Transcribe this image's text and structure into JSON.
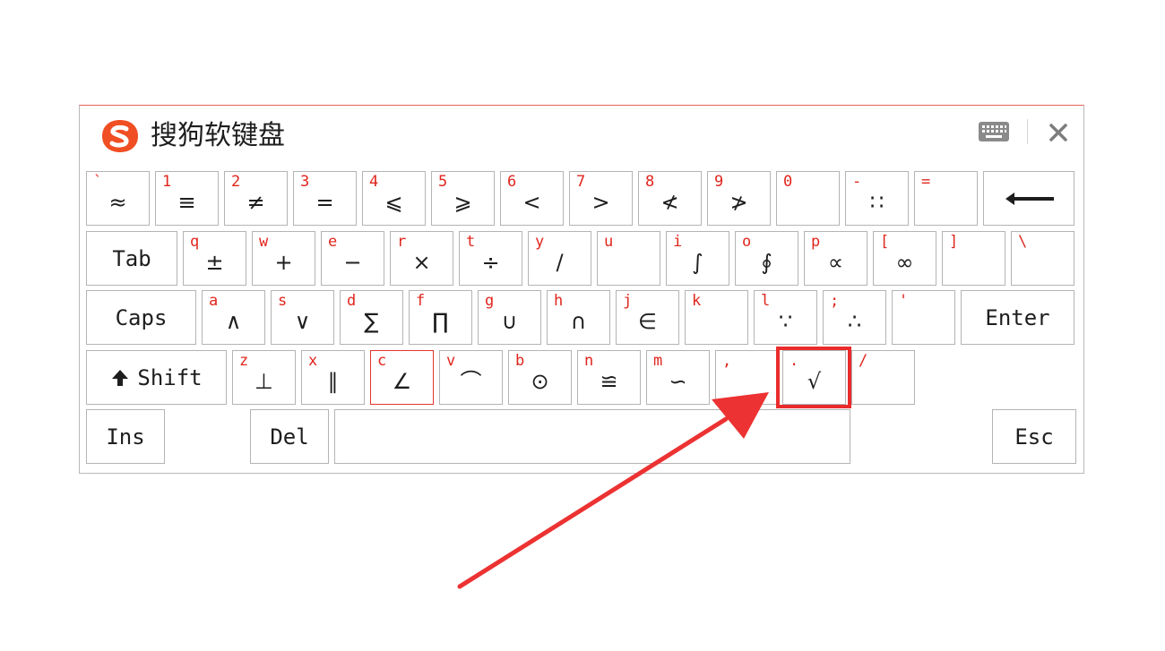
{
  "window": {
    "title": "搜狗软键盘"
  },
  "accent_color": "#e0261d",
  "highlight_color": "#ea2b2b",
  "icons": [
    "sogou-logo-icon",
    "keyboard-icon",
    "close-icon",
    "backspace-arrow-icon",
    "shift-arrow-icon"
  ],
  "keys": {
    "backtick": {
      "ch": "`",
      "sym": "≈"
    },
    "k1": {
      "ch": "1",
      "sym": "≡"
    },
    "k2": {
      "ch": "2",
      "sym": "≠"
    },
    "k3": {
      "ch": "3",
      "sym": "="
    },
    "k4": {
      "ch": "4",
      "sym": "⩽"
    },
    "k5": {
      "ch": "5",
      "sym": "⩾"
    },
    "k6": {
      "ch": "6",
      "sym": "<"
    },
    "k7": {
      "ch": "7",
      "sym": ">"
    },
    "k8": {
      "ch": "8",
      "sym": "≮"
    },
    "k9": {
      "ch": "9",
      "sym": "≯"
    },
    "k0": {
      "ch": "0",
      "sym": ""
    },
    "minus": {
      "ch": "-",
      "sym": "∷"
    },
    "equal": {
      "ch": "=",
      "sym": ""
    },
    "tab": {
      "label": "Tab"
    },
    "q": {
      "ch": "q",
      "sym": "±"
    },
    "w": {
      "ch": "w",
      "sym": "+"
    },
    "e": {
      "ch": "e",
      "sym": "−"
    },
    "r": {
      "ch": "r",
      "sym": "×"
    },
    "t": {
      "ch": "t",
      "sym": "÷"
    },
    "y": {
      "ch": "y",
      "sym": "∕"
    },
    "u": {
      "ch": "u",
      "sym": ""
    },
    "i": {
      "ch": "i",
      "sym": "∫"
    },
    "o": {
      "ch": "o",
      "sym": "∮"
    },
    "p": {
      "ch": "p",
      "sym": "∝"
    },
    "lbracket": {
      "ch": "[",
      "sym": "∞"
    },
    "rbracket": {
      "ch": "]",
      "sym": ""
    },
    "backslash": {
      "ch": "\\",
      "sym": ""
    },
    "caps": {
      "label": "Caps"
    },
    "a": {
      "ch": "a",
      "sym": "∧"
    },
    "s": {
      "ch": "s",
      "sym": "∨"
    },
    "d": {
      "ch": "d",
      "sym": "∑"
    },
    "f": {
      "ch": "f",
      "sym": "∏"
    },
    "g": {
      "ch": "g",
      "sym": "∪"
    },
    "h": {
      "ch": "h",
      "sym": "∩"
    },
    "j": {
      "ch": "j",
      "sym": "∈"
    },
    "k": {
      "ch": "k",
      "sym": ""
    },
    "l": {
      "ch": "l",
      "sym": "∵"
    },
    "semicolon": {
      "ch": ";",
      "sym": "∴"
    },
    "quote": {
      "ch": "'",
      "sym": ""
    },
    "enter": {
      "label": "Enter"
    },
    "shift": {
      "label": "Shift"
    },
    "z": {
      "ch": "z",
      "sym": "⊥"
    },
    "x": {
      "ch": "x",
      "sym": "∥"
    },
    "c": {
      "ch": "c",
      "sym": "∠"
    },
    "v": {
      "ch": "v",
      "sym": "⌒"
    },
    "b": {
      "ch": "b",
      "sym": "⊙"
    },
    "n": {
      "ch": "n",
      "sym": "≌"
    },
    "m": {
      "ch": "m",
      "sym": "∽"
    },
    "comma": {
      "ch": ",",
      "sym": ""
    },
    "period": {
      "ch": ".",
      "sym": "√"
    },
    "slash": {
      "ch": "/",
      "sym": ""
    },
    "ins": {
      "label": "Ins"
    },
    "del": {
      "label": "Del"
    },
    "esc": {
      "label": "Esc"
    }
  }
}
